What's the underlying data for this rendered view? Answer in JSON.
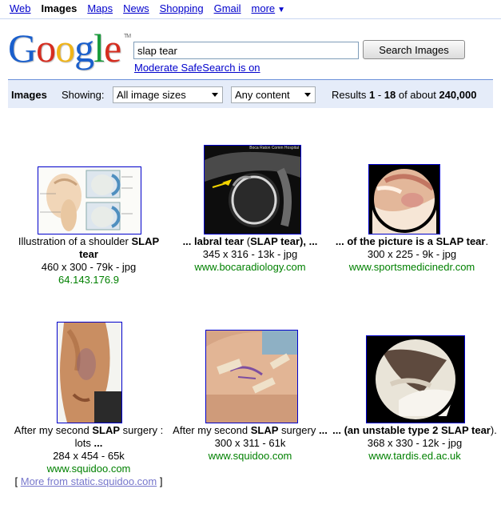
{
  "topnav": {
    "items": [
      "Web",
      "Images",
      "Maps",
      "News",
      "Shopping",
      "Gmail",
      "more"
    ],
    "more_caret": "▼"
  },
  "logo": {
    "letters": [
      "G",
      "o",
      "o",
      "g",
      "l",
      "e"
    ],
    "colors": [
      "#1a5fcc",
      "#d62d20",
      "#f0b418",
      "#1a5fcc",
      "#1a9c3c",
      "#d62d20"
    ],
    "tm": "TM"
  },
  "search": {
    "query": "slap tear",
    "button_label": "Search Images",
    "safesearch": "Moderate SafeSearch is on"
  },
  "bar": {
    "title": "Images",
    "showing_label": "Showing:",
    "size_select": "All image sizes",
    "content_select": "Any content",
    "results_prefix": "Results ",
    "results_start": "1",
    "results_dash": " - ",
    "results_end": "18",
    "results_mid": " of about ",
    "results_total": "240,000"
  },
  "results": [
    {
      "caption_pre": "Illustration of a shoulder ",
      "caption_bold": "SLAP",
      "caption_line2_bold": "tear",
      "meta": "460 x 300 - 79k - jpg",
      "site": "64.143.176.9",
      "thumb": "diagram"
    },
    {
      "caption_pre": "... labral ",
      "caption_bold": "tear",
      "caption_mid": " (",
      "caption_bold2": "SLAP tear",
      "caption_post": "), ...",
      "meta": "345 x 316 - 13k - jpg",
      "site": "www.bocaradiology.com",
      "thumb": "mri",
      "thumb_text": "Boca Raton Comm Hospital"
    },
    {
      "caption_pre": "... of the picture is a ",
      "caption_bold": "SLAP tear",
      "caption_post": ".",
      "meta": "300 x 225 - 9k - jpg",
      "site": "www.sportsmedicinedr.com",
      "thumb": "arthroscopy"
    },
    {
      "caption_pre": "After my second ",
      "caption_bold": "SLAP",
      "caption_post": " surgery :",
      "caption_line2": "lots ",
      "caption_line2_bold": "...",
      "meta": "284 x 454 - 65k",
      "site": "www.squidoo.com",
      "more_open": "[ ",
      "more_link": "More from static.squidoo.com",
      "more_close": " ]",
      "thumb": "arm"
    },
    {
      "caption_pre": "After my second ",
      "caption_bold": "SLAP",
      "caption_post": " surgery ",
      "caption_bold2": "...",
      "meta": "300 x 311 - 61k",
      "site": "www.squidoo.com",
      "thumb": "shoulder"
    },
    {
      "caption_pre": "... (an unstable type 2 ",
      "caption_bold": "SLAP tear",
      "caption_post": ").",
      "meta": "368 x 330 - 12k - jpg",
      "site": "www.tardis.ed.ac.uk",
      "thumb": "scope2"
    }
  ]
}
